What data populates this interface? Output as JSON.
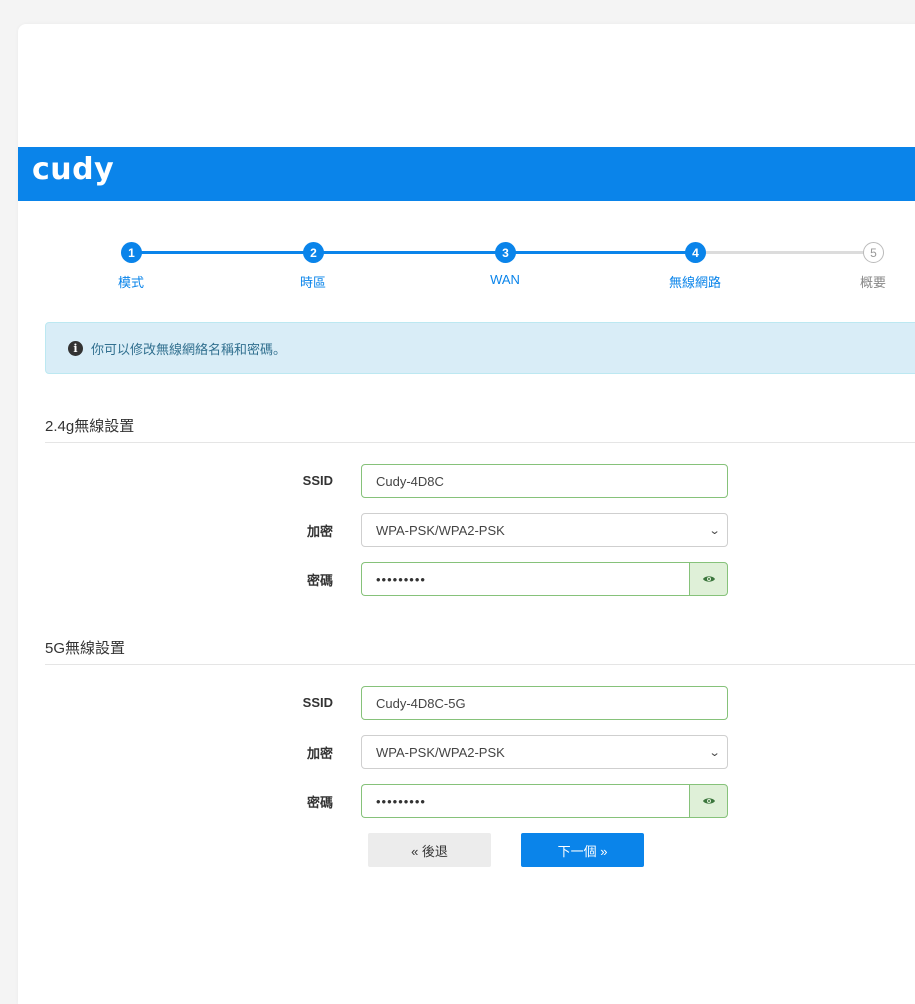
{
  "brand": {
    "logo_text": "cudy",
    "color": "#0a84ea"
  },
  "stepper": {
    "steps": [
      {
        "number": "1",
        "label": "模式",
        "state": "done"
      },
      {
        "number": "2",
        "label": "時區",
        "state": "done"
      },
      {
        "number": "3",
        "label": "WAN",
        "state": "done"
      },
      {
        "number": "4",
        "label": "無線網路",
        "state": "current"
      },
      {
        "number": "5",
        "label": "概要",
        "state": "todo"
      }
    ]
  },
  "alert": {
    "icon": "info-icon",
    "text": "你可以修改無線網絡名稱和密碼。"
  },
  "wifi_24": {
    "title": "2.4g無線設置",
    "ssid_label": "SSID",
    "ssid_value": "Cudy-4D8C",
    "encryption_label": "加密",
    "encryption_value": "WPA-PSK/WPA2-PSK",
    "password_label": "密碼",
    "password_value": "•••••••••"
  },
  "wifi_5": {
    "title": "5G無線設置",
    "ssid_label": "SSID",
    "ssid_value": "Cudy-4D8C-5G",
    "encryption_label": "加密",
    "encryption_value": "WPA-PSK/WPA2-PSK",
    "password_label": "密碼",
    "password_value": "•••••••••"
  },
  "actions": {
    "back_label": "« 後退",
    "next_label": "下一個 »"
  }
}
